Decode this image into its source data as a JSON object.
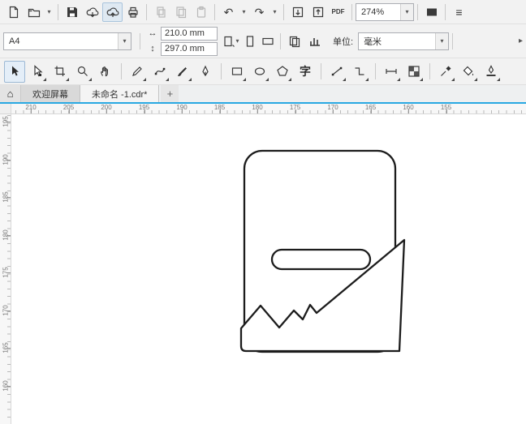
{
  "toolbar": {
    "zoom_value": "274%",
    "pdf_label": "PDF"
  },
  "property_bar": {
    "page_size": "A4",
    "width_value": "210.0 mm",
    "height_value": "297.0 mm",
    "units_label": "单位:",
    "units_value": "毫米"
  },
  "toolbox": {
    "text_tool_glyph": "字"
  },
  "tabs": {
    "welcome_label": "欢迎屏幕",
    "document_label": "未命名 -1.cdr*",
    "new_tab_label": "+"
  },
  "icons": {
    "home": "⌂",
    "undo": "↶",
    "redo": "↷",
    "dropdown": "▾",
    "overflow": "▸",
    "menu": "≡",
    "width": "↔",
    "height": "↕"
  },
  "rulers": {
    "horizontal": [
      210,
      205,
      200,
      195,
      190,
      185,
      180,
      175,
      170,
      165,
      160,
      155
    ],
    "vertical": [
      195,
      190,
      185,
      180,
      175,
      170,
      165,
      160
    ]
  }
}
